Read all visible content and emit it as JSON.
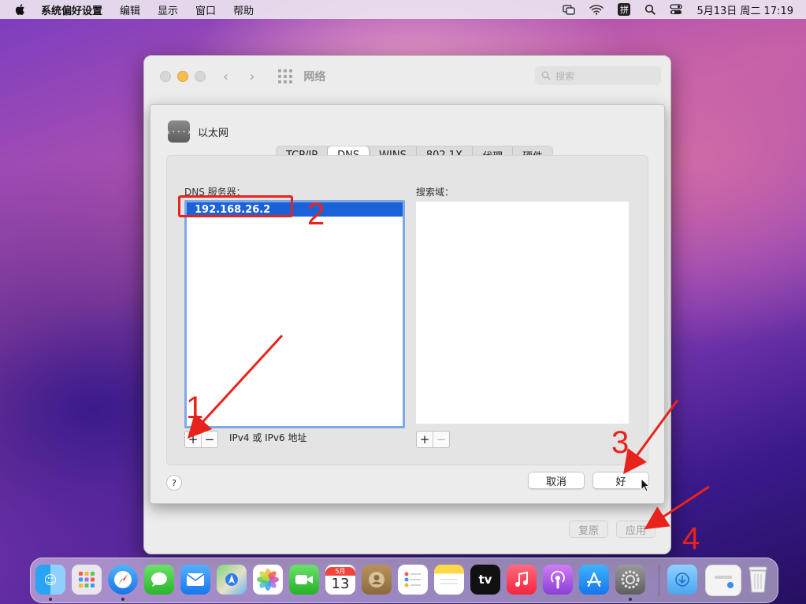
{
  "menubar": {
    "app_name": "系统偏好设置",
    "items": [
      "编辑",
      "显示",
      "窗口",
      "帮助"
    ],
    "ime_label": "拼",
    "datetime": "5月13日 周二  17:19"
  },
  "window": {
    "title": "网络",
    "search_placeholder": "搜索",
    "revert_label": "复原",
    "apply_label": "应用"
  },
  "sheet": {
    "title": "以太网",
    "tabs": [
      "TCP/IP",
      "DNS",
      "WINS",
      "802.1X",
      "代理",
      "硬件"
    ],
    "active_tab": "DNS",
    "dns_servers_label": "DNS 服务器：",
    "dns_servers": [
      "192.168.26.2"
    ],
    "search_domains_label": "搜索域：",
    "add_symbol": "+",
    "remove_symbol": "−",
    "address_hint": "IPv4 或 IPv6 地址",
    "help_label": "?",
    "cancel_label": "取消",
    "ok_label": "好"
  },
  "annotations": [
    "1",
    "2",
    "3",
    "4"
  ],
  "dock": {
    "calendar_month": "5月",
    "calendar_day": "13",
    "tv_label": "tv",
    "apps": [
      "finder",
      "launchpad",
      "safari",
      "messages",
      "mail",
      "maps",
      "photos",
      "facetime",
      "calendar",
      "contacts",
      "reminders",
      "notes",
      "tv",
      "music",
      "podcasts",
      "app-store",
      "system-preferences",
      "downloads",
      "documents",
      "trash"
    ]
  },
  "colors": {
    "selection": "#1b62d9",
    "annotation_red": "#e8231b",
    "list_focus": "#7fa8e8"
  }
}
